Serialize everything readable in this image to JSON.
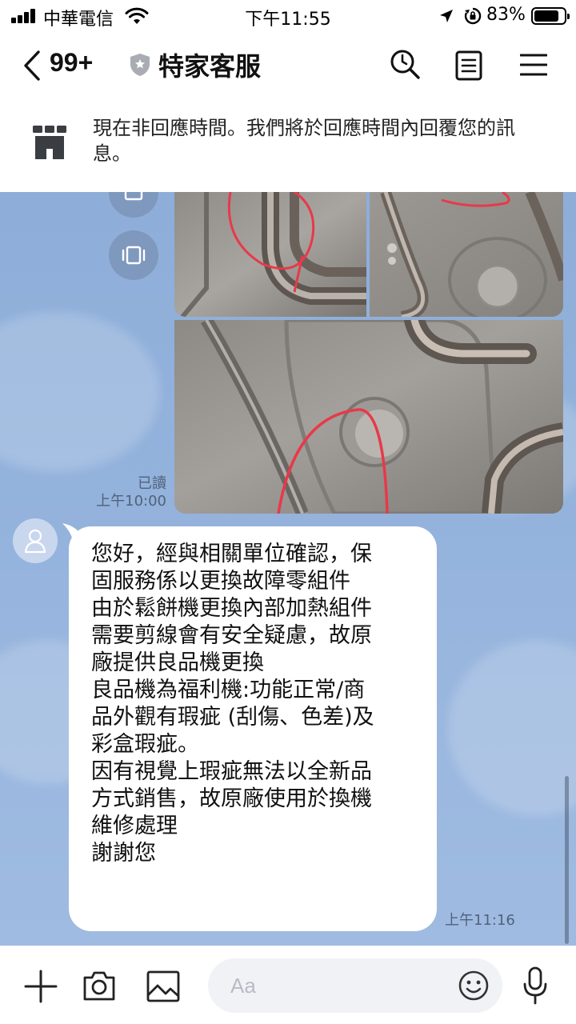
{
  "status_bar": {
    "carrier": "中華電信",
    "time": "下午11:55",
    "battery_percent": "83%",
    "battery_level": 0.83
  },
  "header": {
    "unread_count": "99+",
    "chat_title": "特家客服"
  },
  "notice": {
    "text": "現在非回應時間。我們將於回應時間內回覆您的訊息。"
  },
  "messages": {
    "sent": {
      "read_label": "已讀",
      "time": "上午10:00"
    },
    "received": {
      "text": "您好，經與相關單位確認，保\n固服務係以更換故障零組件\n由於鬆餅機更換內部加熱組件\n需要剪線會有安全疑慮，故原\n廠提供良品機更換\n良品機為福利機:功能正常/商\n品外觀有瑕疵 (刮傷、色差)及\n彩盒瑕疵。\n因有視覺上瑕疵無法以全新品\n方式銷售，故原廠使用於換機\n維修處理\n謝謝您",
      "time": "上午11:16"
    }
  },
  "input_bar": {
    "placeholder": "Aa"
  },
  "icons": {
    "back": "chevron-left-icon",
    "verified": "shield-icon",
    "search": "search-icon",
    "notes": "note-icon",
    "menu": "menu-icon",
    "store": "store-icon",
    "plus": "plus-icon",
    "camera": "camera-icon",
    "image": "image-icon",
    "emoji": "emoji-icon",
    "mic": "mic-icon"
  },
  "colors": {
    "chat_background": "#93b2dc",
    "annotation_red": "#e8394a"
  }
}
